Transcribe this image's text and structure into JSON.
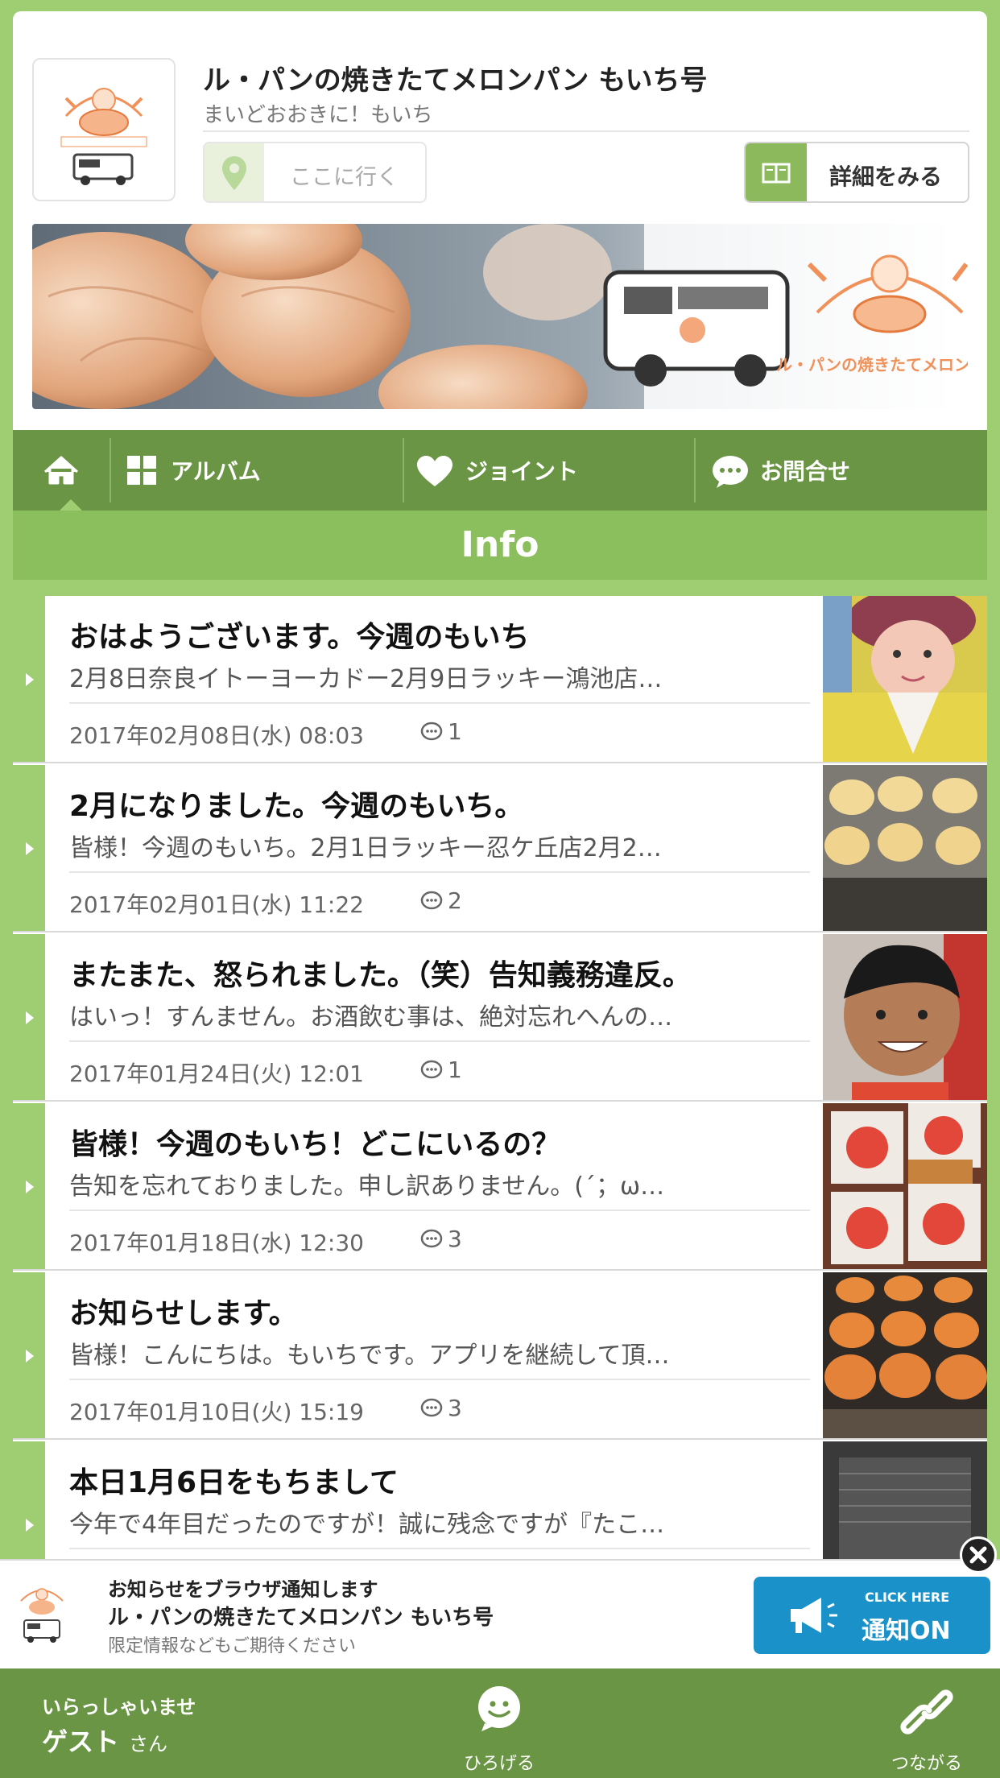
{
  "shop": {
    "name": "ル・パンの焼きたてメロンパン もいち号",
    "subtitle": "まいどおおきに！もいち",
    "goto_label": "ここに行く",
    "detail_label": "詳細をみる",
    "banner_logo_text": "ル・パンの焼きたてメロンパン"
  },
  "nav": {
    "items": [
      {
        "label": "アルバム",
        "icon": "grid-icon"
      },
      {
        "label": "ジョイント",
        "icon": "heart-icon"
      },
      {
        "label": "お問合せ",
        "icon": "chat-icon"
      }
    ]
  },
  "section_title": "Info",
  "posts": [
    {
      "title": "おはようございます。今週のもいち",
      "excerpt": "2月8日奈良イトーヨーカドー2月9日ラッキー鴻池店…",
      "date": "2017年02月08日(水) 08:03",
      "comments": "1"
    },
    {
      "title": "2月になりました。今週のもいち。",
      "excerpt": "皆様！今週のもいち。2月1日ラッキー忍ケ丘店2月2…",
      "date": "2017年02月01日(水) 11:22",
      "comments": "2"
    },
    {
      "title": "またまた、怒られました。（笑）告知義務違反。",
      "excerpt": "はいっ！すんません。お酒飲む事は、絶対忘れへんの…",
      "date": "2017年01月24日(火) 12:01",
      "comments": "1"
    },
    {
      "title": "皆様！今週のもいち！どこにいるの？",
      "excerpt": "告知を忘れておりました。申し訳ありません。(´；ω…",
      "date": "2017年01月18日(水) 12:30",
      "comments": "3"
    },
    {
      "title": "お知らせします。",
      "excerpt": "皆様！こんにちは。もいちです。アプリを継続して頂…",
      "date": "2017年01月10日(火) 15:19",
      "comments": "3"
    },
    {
      "title": "本日1月6日をもちまして",
      "excerpt": "今年で4年目だったのですが！誠に残念ですが『たこ…",
      "date": "",
      "comments": ""
    }
  ],
  "notify": {
    "line1": "お知らせをブラウザ通知します",
    "line2": "ル・パンの焼きたてメロンパン もいち号",
    "line3": "限定情報などもご期待ください",
    "button_small": "CLICK HERE",
    "button_main": "通知ON"
  },
  "footer": {
    "greeting": "いらっしゃいませ",
    "guest": "ゲスト",
    "san": "さん",
    "hirogeru": "ひろげる",
    "tsunagaru": "つながる"
  },
  "colors": {
    "bg_green": "#9fcd72",
    "nav_green": "#6a9544",
    "info_green": "#8bbe5c",
    "notify_blue": "#1a92c9",
    "logo_orange": "#f0915a"
  }
}
